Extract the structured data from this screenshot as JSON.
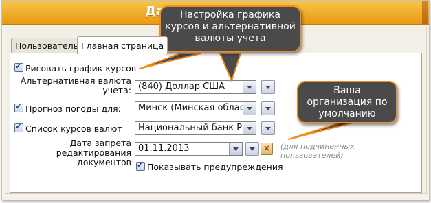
{
  "window": {
    "title": "Да"
  },
  "tabs": [
    {
      "label": "Пользователь",
      "active": false
    },
    {
      "label": "Главная страница",
      "active": true
    }
  ],
  "form": {
    "draw_chart": {
      "label": "Рисовать график курсов",
      "checked": true
    },
    "alt_currency": {
      "label_line1": "Альтернативная валюта",
      "label_line2": "учета:",
      "value": "(840) Доллар США"
    },
    "weather": {
      "label": "Прогноз погоды для:",
      "checked": true,
      "value": "Минск (Минская область)"
    },
    "rates": {
      "label": "Список курсов валют",
      "checked": true,
      "value": "Национальный банк Респу"
    },
    "ban_date": {
      "label_line1": "Дата запрета",
      "label_line2": "редактирования документов",
      "value": "01.11.2013",
      "hint_line1": "(для подчиненных",
      "hint_line2": "пользователей)"
    },
    "show_warnings": {
      "label": "Показывать предупреждения",
      "checked": true
    }
  },
  "callouts": {
    "top": {
      "line1": "Настройка графика",
      "line2": "курсов и альтернативной",
      "line3": "валюты учета"
    },
    "right": {
      "line1": "Ваша",
      "line2": "организация по",
      "line3": "умолчанию"
    }
  },
  "colors": {
    "accent_orange": "#f28c1e",
    "title_bar": "#e89a12",
    "callout_bg": "#4a4a4a"
  }
}
